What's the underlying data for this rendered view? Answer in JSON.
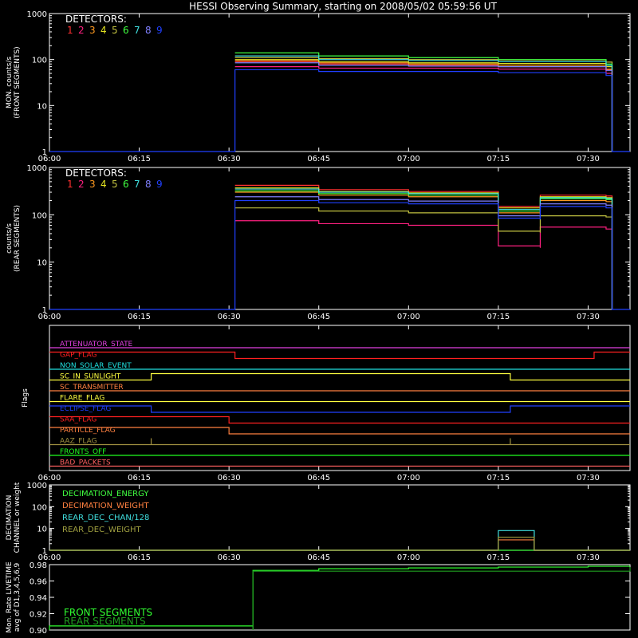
{
  "title": "HESSI Observing Summary, starting on 2008/05/02 05:59:56 UT",
  "colors": {
    "det": [
      "#ff3030",
      "#ff2080",
      "#ff9a20",
      "#e0e020",
      "#c0c040",
      "#40ff40",
      "#40e0e0",
      "#8080ff",
      "#2040ff"
    ],
    "axis": "#ffffff",
    "flag_magenta": "#e040e0",
    "flag_red": "#ff2020",
    "flag_cyan": "#20e0e0",
    "flag_yellow": "#ffff40",
    "flag_orange": "#ff8040",
    "flag_blue": "#2040ff",
    "flag_olive": "#a09040",
    "flag_green": "#20ff20",
    "flag_salmon": "#ff6060",
    "dec_green": "#40ff40",
    "dec_orange": "#ff8040",
    "dec_cyan": "#40e0e0",
    "dec_olive": "#a0a040",
    "live_front": "#30ff30",
    "live_rear": "#20a020"
  },
  "chart_data": [
    {
      "id": "front",
      "type": "line",
      "ylabel": [
        "MON. counts/s",
        "(FRONT SEGMENTS)"
      ],
      "ylim": [
        1,
        1000
      ],
      "yscale": "log",
      "xlim": [
        "06:00",
        "07:37"
      ],
      "x_ticks": [
        "06:00",
        "06:15",
        "06:30",
        "06:45",
        "07:00",
        "07:15",
        "07:30"
      ],
      "y_ticks": [
        "1",
        "10",
        "100",
        "1000"
      ],
      "legend_title": "DETECTORS:",
      "legend_items": [
        "1",
        "2",
        "3",
        "4",
        "5",
        "6",
        "7",
        "8",
        "9"
      ],
      "series": [
        {
          "name": "1",
          "x": [
            "06:31",
            "06:45",
            "07:00",
            "07:15",
            "07:33",
            "07:34"
          ],
          "values": [
            90,
            80,
            75,
            70,
            60,
            1
          ]
        },
        {
          "name": "2",
          "x": [
            "06:31",
            "06:45",
            "07:00",
            "07:15",
            "07:33",
            "07:34"
          ],
          "values": [
            70,
            65,
            65,
            62,
            50,
            1
          ]
        },
        {
          "name": "3",
          "x": [
            "06:31",
            "06:45",
            "07:00",
            "07:15",
            "07:33",
            "07:34"
          ],
          "values": [
            95,
            85,
            80,
            75,
            62,
            1
          ]
        },
        {
          "name": "4",
          "x": [
            "06:31",
            "06:45",
            "07:00",
            "07:15",
            "07:33",
            "07:34"
          ],
          "values": [
            100,
            90,
            85,
            82,
            70,
            1
          ]
        },
        {
          "name": "5",
          "x": [
            "06:31",
            "06:45",
            "07:00",
            "07:15",
            "07:33",
            "07:34"
          ],
          "values": [
            110,
            105,
            100,
            98,
            88,
            1
          ]
        },
        {
          "name": "6",
          "x": [
            "06:31",
            "06:45",
            "07:00",
            "07:15",
            "07:33",
            "07:34"
          ],
          "values": [
            140,
            120,
            110,
            100,
            80,
            1
          ]
        },
        {
          "name": "7",
          "x": [
            "06:31",
            "06:45",
            "07:00",
            "07:15",
            "07:33",
            "07:34"
          ],
          "values": [
            120,
            100,
            95,
            90,
            75,
            1
          ]
        },
        {
          "name": "8",
          "x": [
            "06:31",
            "06:45",
            "07:00",
            "07:15",
            "07:33",
            "07:34"
          ],
          "values": [
            85,
            75,
            72,
            70,
            58,
            1
          ]
        },
        {
          "name": "9",
          "x": [
            "06:00",
            "06:31",
            "06:31",
            "06:45",
            "07:00",
            "07:15",
            "07:33",
            "07:34",
            "07:37"
          ],
          "values": [
            1,
            1,
            60,
            55,
            55,
            52,
            45,
            1,
            1
          ]
        }
      ]
    },
    {
      "id": "rear",
      "type": "line",
      "ylabel": [
        "counts/s",
        "(REAR SEGMENTS)"
      ],
      "ylim": [
        1,
        1000
      ],
      "yscale": "log",
      "xlim": [
        "06:00",
        "07:37"
      ],
      "x_ticks": [
        "06:00",
        "06:15",
        "06:30",
        "06:45",
        "07:00",
        "07:15",
        "07:30"
      ],
      "y_ticks": [
        "1",
        "10",
        "100",
        "1000"
      ],
      "legend_title": "DETECTORS:",
      "legend_items": [
        "1",
        "2",
        "3",
        "4",
        "5",
        "6",
        "7",
        "8",
        "9"
      ],
      "series": [
        {
          "name": "1",
          "x": [
            "06:31",
            "06:45",
            "07:00",
            "07:15",
            "07:15",
            "07:22",
            "07:22",
            "07:33",
            "07:34"
          ],
          "values": [
            420,
            340,
            310,
            290,
            150,
            140,
            260,
            250,
            1
          ]
        },
        {
          "name": "2",
          "x": [
            "06:31",
            "06:45",
            "07:00",
            "07:15",
            "07:15",
            "07:22",
            "07:22",
            "07:33",
            "07:34"
          ],
          "values": [
            75,
            65,
            60,
            55,
            22,
            20,
            55,
            50,
            1
          ]
        },
        {
          "name": "3",
          "x": [
            "06:31",
            "06:45",
            "07:00",
            "07:15",
            "07:15",
            "07:22",
            "07:22",
            "07:33",
            "07:34"
          ],
          "values": [
            300,
            260,
            240,
            220,
            110,
            100,
            200,
            190,
            1
          ]
        },
        {
          "name": "4",
          "x": [
            "06:31",
            "06:45",
            "07:00",
            "07:15",
            "07:15",
            "07:22",
            "07:22",
            "07:33",
            "07:34"
          ],
          "values": [
            370,
            310,
            290,
            270,
            140,
            130,
            240,
            230,
            1
          ]
        },
        {
          "name": "5",
          "x": [
            "06:31",
            "06:45",
            "07:00",
            "07:15",
            "07:15",
            "07:22",
            "07:22",
            "07:33",
            "07:34"
          ],
          "values": [
            140,
            120,
            110,
            100,
            45,
            42,
            95,
            90,
            1
          ]
        },
        {
          "name": "6",
          "x": [
            "06:31",
            "06:45",
            "07:00",
            "07:15",
            "07:15",
            "07:22",
            "07:22",
            "07:33",
            "07:34"
          ],
          "values": [
            320,
            280,
            260,
            240,
            120,
            110,
            220,
            210,
            1
          ]
        },
        {
          "name": "7",
          "x": [
            "06:31",
            "06:45",
            "07:00",
            "07:15",
            "07:15",
            "07:22",
            "07:22",
            "07:33",
            "07:34"
          ],
          "values": [
            350,
            300,
            280,
            260,
            130,
            120,
            230,
            220,
            1
          ]
        },
        {
          "name": "8",
          "x": [
            "06:31",
            "06:45",
            "07:00",
            "07:15",
            "07:15",
            "07:22",
            "07:22",
            "07:33",
            "07:34"
          ],
          "values": [
            240,
            210,
            195,
            180,
            95,
            90,
            170,
            160,
            1
          ]
        },
        {
          "name": "9",
          "x": [
            "06:00",
            "06:31",
            "06:31",
            "06:45",
            "07:00",
            "07:15",
            "07:15",
            "07:22",
            "07:22",
            "07:33",
            "07:34",
            "07:37"
          ],
          "values": [
            1,
            1,
            200,
            180,
            170,
            160,
            85,
            80,
            150,
            140,
            1,
            1
          ]
        }
      ]
    },
    {
      "id": "flags",
      "type": "line",
      "ylabel": [
        "Flags"
      ],
      "xlim": [
        "06:00",
        "07:37"
      ],
      "x_ticks": [
        "06:00",
        "06:15",
        "06:30",
        "06:45",
        "07:00",
        "07:15",
        "07:30"
      ],
      "flags": [
        {
          "label": "ATTENUATOR_STATE",
          "color_key": "flag_magenta",
          "transitions": []
        },
        {
          "label": "GAP_FLAG",
          "color_key": "flag_red",
          "transitions": [
            [
              "06:31",
              -1
            ],
            [
              "07:31",
              1
            ]
          ]
        },
        {
          "label": "NON_SOLAR_EVENT",
          "color_key": "flag_cyan",
          "transitions": []
        },
        {
          "label": "SC_IN_SUNLIGHT",
          "color_key": "flag_yellow",
          "transitions": [
            [
              "06:17",
              1
            ],
            [
              "07:17",
              -1
            ]
          ]
        },
        {
          "label": "SC_TRANSMITTER",
          "color_key": "flag_orange",
          "transitions": []
        },
        {
          "label": "FLARE_FLAG",
          "color_key": "flag_yellow",
          "transitions": []
        },
        {
          "label": "ECLIPSE_FLAG",
          "color_key": "flag_blue",
          "transitions": [
            [
              "06:17",
              -1
            ],
            [
              "07:17",
              1
            ]
          ]
        },
        {
          "label": "SAA_FLAG",
          "color_key": "flag_red",
          "transitions": [
            [
              "06:30",
              -1
            ]
          ]
        },
        {
          "label": "PARTICLE_FLAG",
          "color_key": "flag_orange",
          "transitions": [
            [
              "06:30",
              -1
            ]
          ]
        },
        {
          "label": "AAZ_FLAG",
          "color_key": "flag_olive",
          "transitions": [
            [
              "06:17",
              1
            ],
            [
              "06:17",
              -1
            ],
            [
              "07:17",
              1
            ],
            [
              "07:17",
              -1
            ]
          ]
        },
        {
          "label": "FRONTS_OFF",
          "color_key": "flag_green",
          "transitions": []
        },
        {
          "label": "BAD_PACKETS",
          "color_key": "flag_salmon",
          "transitions": []
        }
      ]
    },
    {
      "id": "decimation",
      "type": "line",
      "ylabel": [
        "DECIMATION",
        "CHANNEL or weight"
      ],
      "ylim": [
        1,
        1000
      ],
      "yscale": "log",
      "xlim": [
        "06:00",
        "07:37"
      ],
      "x_ticks": [
        "06:00",
        "06:15",
        "06:30",
        "06:45",
        "07:00",
        "07:15",
        "07:30"
      ],
      "y_ticks": [
        "1",
        "10",
        "100",
        "1000"
      ],
      "series": [
        {
          "name": "DECIMATION_ENERGY",
          "color_key": "dec_green",
          "x": [
            "06:00",
            "07:37"
          ],
          "values": [
            0.5,
            0.5
          ]
        },
        {
          "name": "DECIMATION_WEIGHT",
          "color_key": "dec_orange",
          "x": [
            "06:00",
            "07:15",
            "07:15",
            "07:21",
            "07:21",
            "07:37"
          ],
          "values": [
            0.5,
            0.5,
            3,
            3,
            0.5,
            0.5
          ]
        },
        {
          "name": "REAR_DEC_CHAN/128",
          "color_key": "dec_cyan",
          "x": [
            "06:00",
            "07:15",
            "07:15",
            "07:21",
            "07:21",
            "07:37"
          ],
          "values": [
            0.5,
            0.5,
            8,
            8,
            0.5,
            0.5
          ]
        },
        {
          "name": "REAR_DEC_WEIGHT",
          "color_key": "dec_olive",
          "x": [
            "06:00",
            "07:15",
            "07:15",
            "07:21",
            "07:21",
            "07:37"
          ],
          "values": [
            0.5,
            0.5,
            4,
            4,
            0.5,
            0.5
          ]
        }
      ]
    },
    {
      "id": "livetime",
      "type": "line",
      "ylabel": [
        "Mon. Rate LIVETIME",
        "avg of D1,3,4,5,6,9"
      ],
      "ylim": [
        0.9,
        0.98
      ],
      "xlim": [
        "06:00",
        "07:37"
      ],
      "y_ticks": [
        "0.90",
        "0.92",
        "0.94",
        "0.96",
        "0.98"
      ],
      "legend_items": [
        "FRONT SEGMENTS",
        "REAR SEGMENTS"
      ],
      "series": [
        {
          "name": "FRONT SEGMENTS",
          "color_key": "live_front",
          "x": [
            "06:00",
            "06:00",
            "06:34",
            "06:34",
            "06:45",
            "07:00",
            "07:15",
            "07:30",
            "07:37"
          ],
          "values": [
            0.9,
            0.905,
            0.9,
            0.973,
            0.975,
            0.976,
            0.977,
            0.978,
            0.978
          ]
        },
        {
          "name": "REAR SEGMENTS",
          "color_key": "live_rear",
          "x": [
            "06:34",
            "06:34",
            "07:37"
          ],
          "values": [
            0.9,
            0.972,
            0.977
          ]
        }
      ]
    }
  ]
}
